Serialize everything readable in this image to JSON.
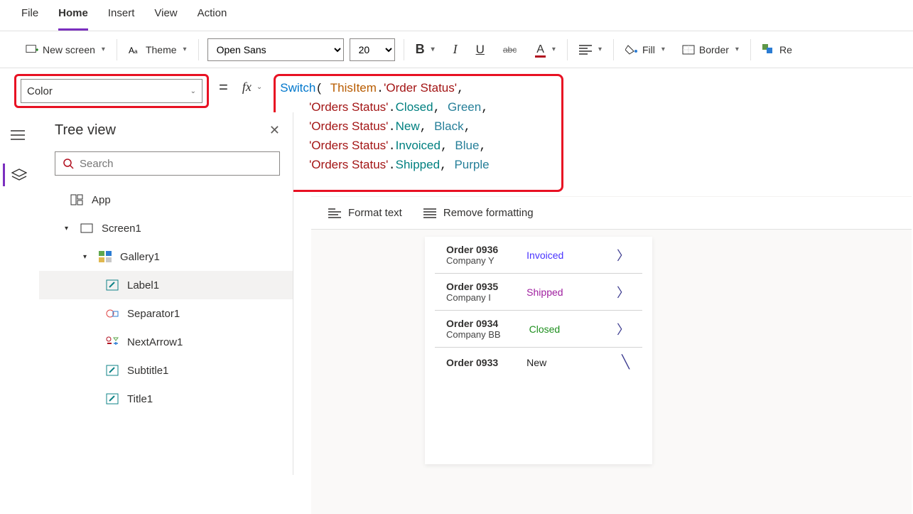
{
  "menu": {
    "file": "File",
    "home": "Home",
    "insert": "Insert",
    "view": "View",
    "action": "Action"
  },
  "ribbon": {
    "newScreen": "New screen",
    "theme": "Theme",
    "fontName": "Open Sans",
    "fontSize": "20",
    "fill": "Fill",
    "border": "Border",
    "reorder": "Re"
  },
  "property": {
    "selected": "Color"
  },
  "fx": "fx",
  "formula": {
    "fn": "Switch",
    "thisItem": "ThisItem",
    "orderStatus": "'Order Status'",
    "ordersStatus": "'Orders Status'",
    "closed": "Closed",
    "green": "Green",
    "new": "New",
    "black": "Black",
    "invoiced": "Invoiced",
    "blue": "Blue",
    "shipped": "Shipped",
    "purple": "Purple"
  },
  "formulaTools": {
    "format": "Format text",
    "remove": "Remove formatting"
  },
  "treeView": {
    "title": "Tree view",
    "searchPlaceholder": "Search",
    "items": {
      "app": "App",
      "screen1": "Screen1",
      "gallery1": "Gallery1",
      "label1": "Label1",
      "separator1": "Separator1",
      "nextArrow1": "NextArrow1",
      "subtitle1": "Subtitle1",
      "title1": "Title1"
    }
  },
  "orders": [
    {
      "title": "Order 0936",
      "company": "Company Y",
      "status": "Invoiced",
      "statusClass": "status-invoiced"
    },
    {
      "title": "Order 0935",
      "company": "Company I",
      "status": "Shipped",
      "statusClass": "status-shipped"
    },
    {
      "title": "Order 0934",
      "company": "Company BB",
      "status": "Closed",
      "statusClass": "status-closed"
    },
    {
      "title": "Order 0933",
      "company": "",
      "status": "New",
      "statusClass": "status-new"
    }
  ]
}
